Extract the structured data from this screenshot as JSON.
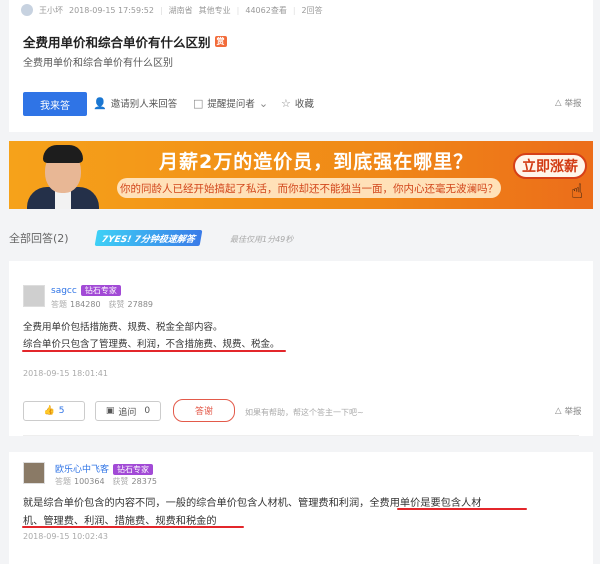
{
  "question": {
    "asker": "王小坏",
    "datetime": "2018-09-15 17:59:52",
    "location": "湖南省",
    "category": "其他专业",
    "views": "44062查看",
    "answers_count": "2回答",
    "title": "全费用单价和综合单价有什么区别",
    "badge": "赏",
    "description": "全费用单价和综合单价有什么区别",
    "answer_button": "我来答",
    "invite": "邀请别人来回答",
    "remind": "提醒提问者",
    "favorite": "收藏",
    "report": "举报"
  },
  "banner": {
    "headline": "月薪2万的造价员，到底强在哪里？",
    "subline": "你的同龄人已经开始搞起了私活，而你却还不能独当一面，你内心还毫无波澜吗？",
    "cta": "立即涨薪"
  },
  "answers_header": {
    "label": "全部回答(2)",
    "fast_badge": "7YES! 7分钟极速解答",
    "fast_note": "最佳仅用1分49秒"
  },
  "answers": [
    {
      "user": "sagcc",
      "role": "钻石专家",
      "answers_label": "答题",
      "answers_value": "184280",
      "likes_label": "获赞",
      "likes_value": "27889",
      "line1": "全费用单价包括措施费、规费、税金全部内容。",
      "line2": "综合单价只包含了管理费、利润，不含措施费、规费、税金。",
      "datetime": "2018-09-15 18:01:41",
      "like_count": "5",
      "reply_label": "追问",
      "reply_count": "0",
      "thanks": "答谢",
      "hint": "如果有帮助，帮这个答主一下吧~",
      "report": "举报"
    },
    {
      "user": "欧乐心中飞客",
      "role": "钻石专家",
      "answers_label": "答题",
      "answers_value": "100364",
      "likes_label": "获赞",
      "likes_value": "28375",
      "line1": "就是综合单价包含的内容不同，一般的综合单价包含人材机、管理费和利润，全费用单价是要包含人材",
      "line2": "机、管理费、利润、措施费、规费和税金的",
      "datetime": "2018-09-15 10:02:43"
    }
  ],
  "colors": {
    "primary": "#2f74e6",
    "banner_orange": "#f08a17",
    "underline_red": "#e3262b",
    "expert_purple": "#a24ad6"
  }
}
